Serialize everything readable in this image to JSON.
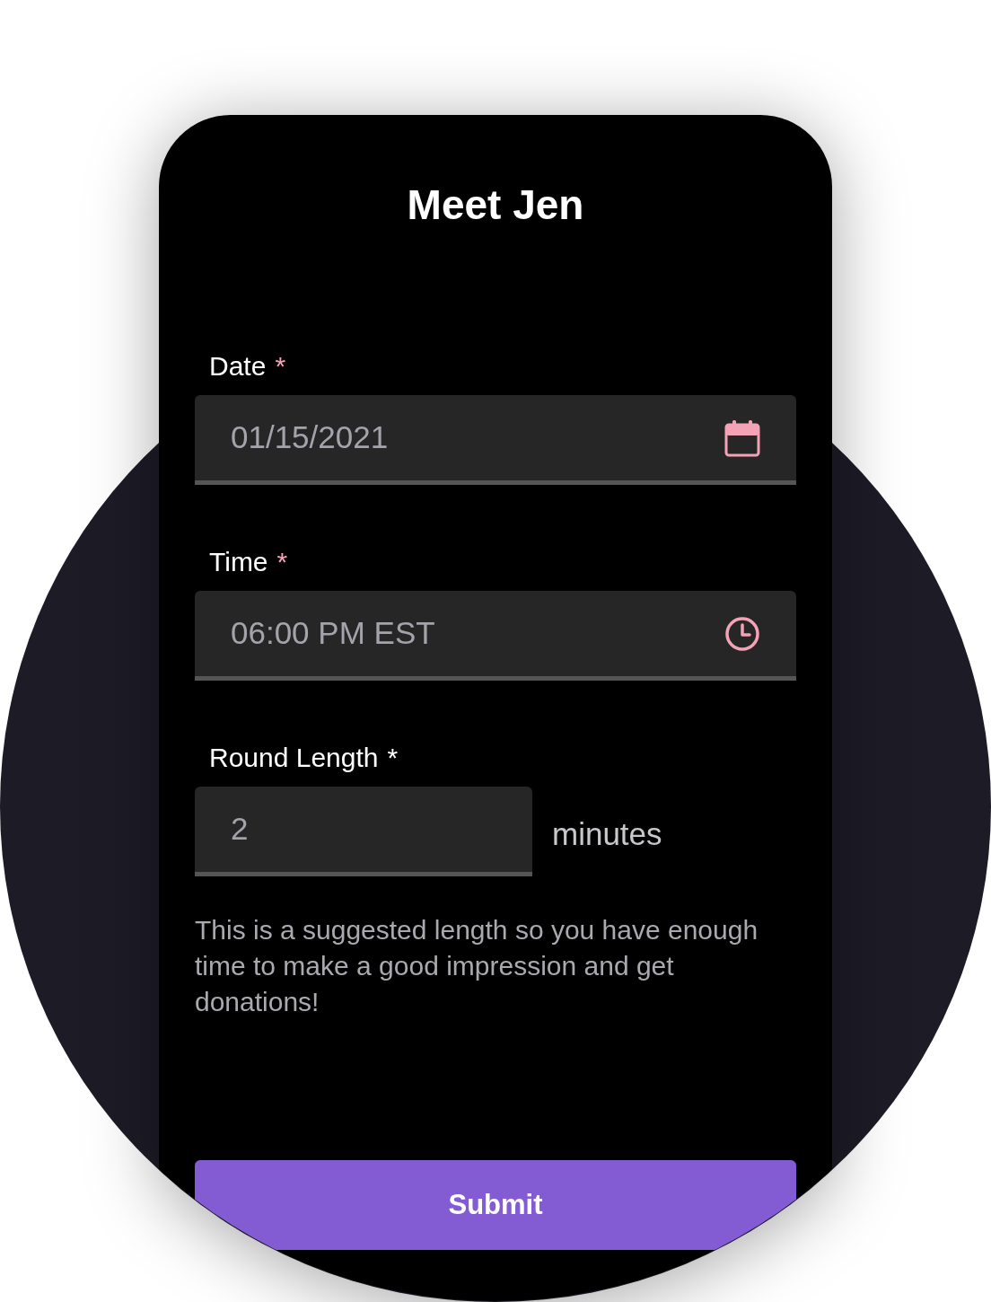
{
  "title": "Meet Jen",
  "fields": [
    {
      "kind": "date",
      "label": "Date",
      "required_mark": "*",
      "color": "#f4a3b6",
      "value": "01/15/2021"
    },
    {
      "kind": "time",
      "label": "Time",
      "required_mark": "*",
      "color": "#f4a3b6",
      "value": "06:00 PM EST"
    },
    {
      "kind": "number",
      "label": "Round Length",
      "required_mark": "*",
      "color": "#ffffff",
      "value": "2",
      "suffix": "minutes"
    }
  ],
  "helper_text": "This is a suggested length so you have enough time to make a good impression and get donations!",
  "submit": "Submit"
}
